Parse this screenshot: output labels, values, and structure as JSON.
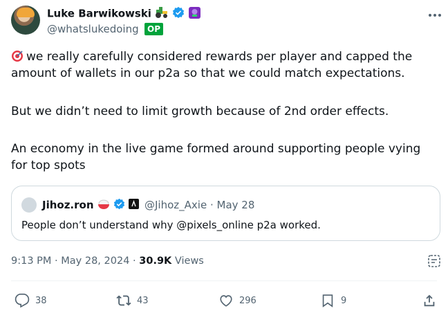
{
  "tweet": {
    "author_name": "Luke Barwikowski",
    "author_handle": "@whatslukedoing",
    "op_badge": "OP",
    "paragraphs": [
      "we really carefully considered rewards per player and capped the amount of wallets in our p2a so that we could match expectations.",
      "But we didn’t need to limit growth because of 2nd order effects.",
      "An economy in the live game formed around supporting people vying for top spots"
    ],
    "time": "9:13 PM",
    "separator": "·",
    "date": "May 28, 2024",
    "views_count": "30.9K",
    "views_label": "Views"
  },
  "quote": {
    "author_name": "Jihoz.ron",
    "author_handle": "@Jihoz_Axie",
    "separator": "·",
    "date": "May 28",
    "text": "People don’t understand why @pixels_online p2a worked."
  },
  "actions": {
    "replies": "38",
    "reposts": "43",
    "likes": "296",
    "bookmarks": "9"
  },
  "colors": {
    "verified": "#1d9bf0",
    "secondary_text": "#536471",
    "op_badge": "#00a33b"
  },
  "icons": [
    "tractor-emoji",
    "verified-badge-icon",
    "purple-flower-badge-icon",
    "more-icon",
    "target-emoji",
    "rice-bowl-emoji",
    "axie-badge-icon",
    "grok-icon",
    "reply-icon",
    "repost-icon",
    "like-icon",
    "bookmark-icon",
    "share-icon"
  ]
}
